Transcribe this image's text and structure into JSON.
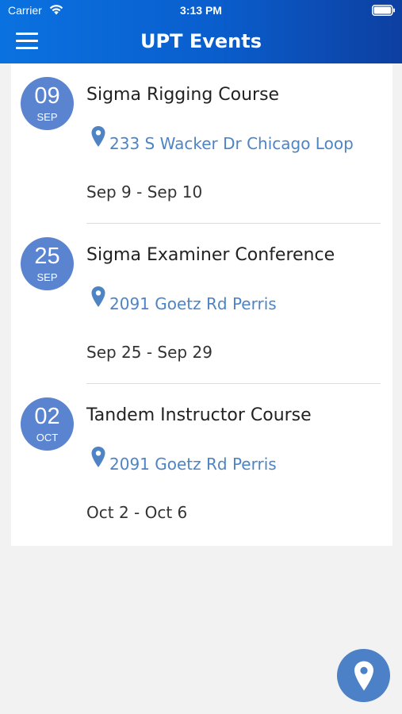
{
  "status_bar": {
    "carrier": "Carrier",
    "time": "3:13 PM",
    "icons": [
      "wifi-icon",
      "battery-icon"
    ]
  },
  "nav": {
    "title": "UPT Events",
    "menu_icon": "hamburger-menu-icon"
  },
  "events": [
    {
      "day": "09",
      "month": "SEP",
      "title": "Sigma Rigging Course",
      "address": "233 S Wacker Dr Chicago Loop",
      "dates": "Sep 9 - Sep 10"
    },
    {
      "day": "25",
      "month": "SEP",
      "title": "Sigma Examiner Conference",
      "address": "2091 Goetz Rd Perris",
      "dates": "Sep 25 - Sep 29"
    },
    {
      "day": "02",
      "month": "OCT",
      "title": "Tandem Instructor Course",
      "address": "2091 Goetz Rd Perris",
      "dates": "Oct 2 - Oct 6"
    }
  ],
  "fab": {
    "icon": "map-pin-icon"
  },
  "colors": {
    "header_start": "#0a72e0",
    "header_end": "#0d3fa0",
    "badge": "#5a84cf",
    "link": "#4f84c4",
    "fab": "#4c80c7",
    "background": "#f2f2f2"
  }
}
